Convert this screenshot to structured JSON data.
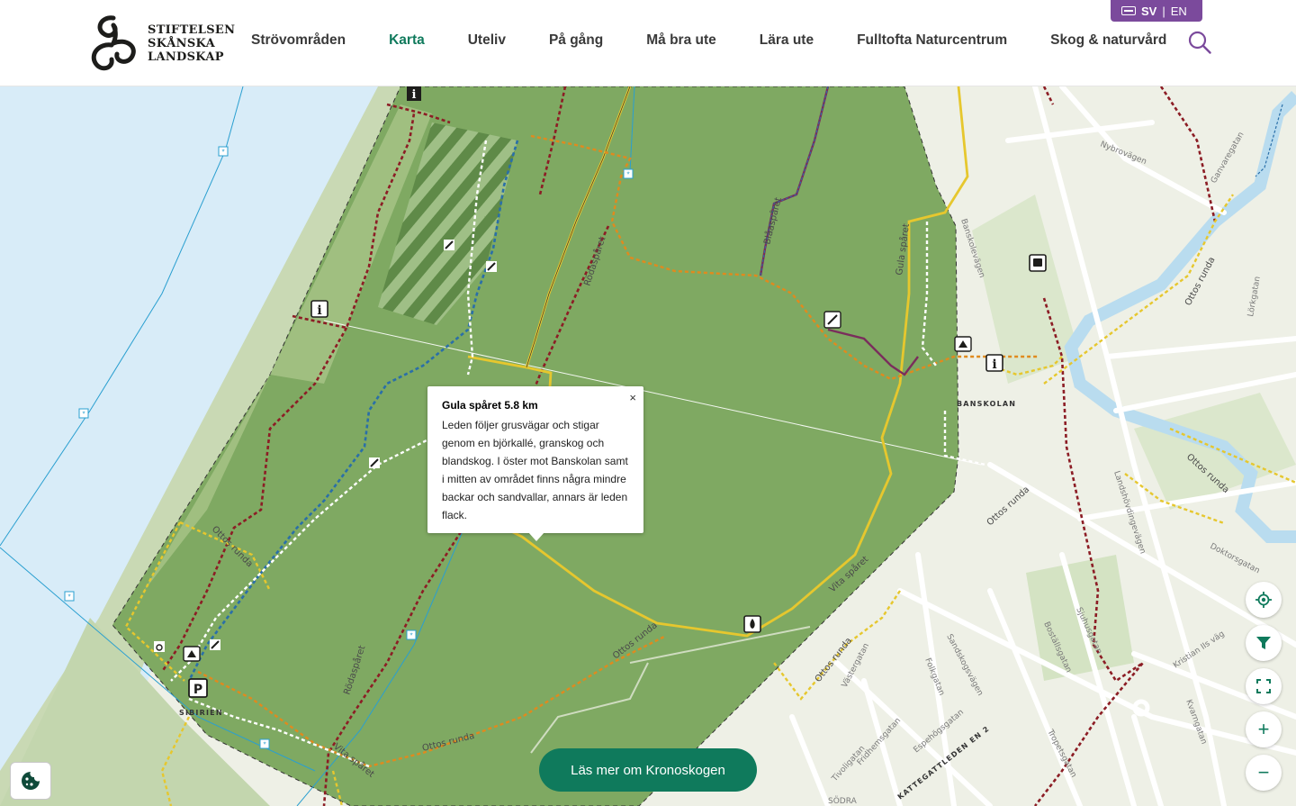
{
  "logo": {
    "lines": [
      "STIFTELSEN",
      "SKÅNSKA",
      "LANDSKAP"
    ]
  },
  "nav": [
    {
      "label": "Strövområden"
    },
    {
      "label": "Karta",
      "active": true
    },
    {
      "label": "Uteliv"
    },
    {
      "label": "På gång"
    },
    {
      "label": "Må bra ute"
    },
    {
      "label": "Lära ute"
    },
    {
      "label": "Fulltofta Naturcentrum"
    },
    {
      "label": "Skog & naturvård"
    }
  ],
  "lang": {
    "sv": "SV",
    "sep": "|",
    "en": "EN"
  },
  "popup": {
    "title": "Gula spåret 5.8 km",
    "body": "Leden följer grusvägar och stigar genom en björkallé, granskog och blandskog. I öster mot Banskolan samt i mitten av området finns några mindre backar och sandvallar, annars är leden flack.",
    "close": "×"
  },
  "cta": {
    "label": "Läs mer om Kronoskogen"
  },
  "map_labels": {
    "trail_ottos_1": "Ottos runda",
    "trail_ottos_2": "Ottos runda",
    "trail_ottos_3": "Ottos runda",
    "trail_ottos_4": "Ottos runda",
    "trail_ottos_5": "Ottos runda",
    "trail_ottos_6": "Ottos runda",
    "trail_ottos_7": "Ottos runda",
    "trail_roda_1": "Rödaspåret",
    "trail_roda_2": "Rödaspåret",
    "trail_bla": "Blåaspåret",
    "trail_gula": "Gula spåret",
    "trail_vita_1": "Vita spåret",
    "trail_vita_2": "Vita spåret",
    "place_banskolan": "BANSKOLAN",
    "place_sibirien": "SIBIRIEN",
    "street_nybrovagen": "Nybrovägen",
    "street_ganvaregatan": "Ganvaregatan",
    "street_landshovdingevagen": "Landshövdingevägen",
    "street_doktorsgatan": "Doktorsgatan",
    "street_kristian": "Kristian IIs väg",
    "street_sjuhusgatan": "Sjuhusgatan",
    "street_bostallsgatan": "Boställsgatan",
    "street_sandskogsvagen": "Sandskogsvägen",
    "street_folkgatan": "Folkgatan",
    "street_espehogsgatan": "Espehögsgatan",
    "street_fridhemsgatan": "Fridhemsgatan",
    "street_vastergatan": "Västergatan",
    "street_tivoligatan": "Tivoligatan",
    "street_kvarngatan": "Kvarngatan",
    "street_tropetsgatan": "Tropetsgatan",
    "street_banskolevagen": "Banskolevägen",
    "street_lorkgatan": "Lörkgatan",
    "street_soder": "SÖDRA",
    "street_kattegattleden": "KATTEGATTLEDEN EN 2",
    "parking": "P",
    "info": "i"
  },
  "colors": {
    "accent": "#0f7a5c",
    "forest": "#7fa962",
    "water": "#d6ebf7",
    "trail_red": "#8c1d25",
    "trail_yellow": "#e6c72e",
    "trail_blue": "#2a6fa8",
    "trail_white": "#ffffff",
    "trail_orange": "#e08a1e",
    "lang_bg": "#7b4a9c"
  },
  "controls": {
    "locate": "locate-icon",
    "filter": "filter-icon",
    "fullscreen": "fullscreen-icon",
    "zoom_in": "+",
    "zoom_out": "−"
  }
}
